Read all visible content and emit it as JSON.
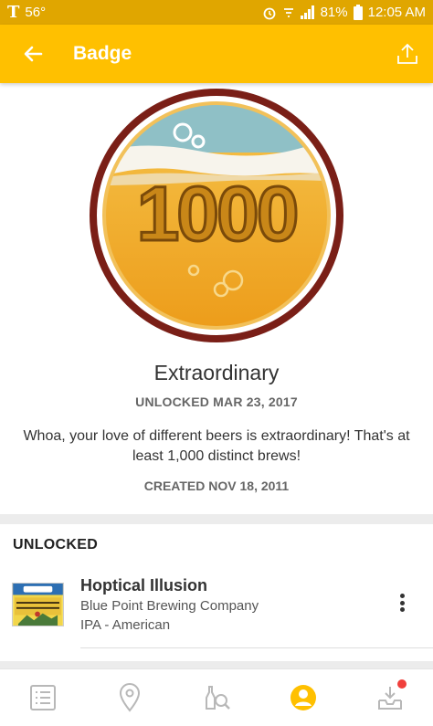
{
  "status_bar": {
    "temperature": "56°",
    "battery": "81%",
    "time": "12:05 AM"
  },
  "app_bar": {
    "title": "Badge"
  },
  "badge": {
    "number_art": "1000",
    "name": "Extraordinary",
    "unlocked_date": "UNLOCKED MAR 23, 2017",
    "description": "Whoa, your love of different beers is extraordinary! That's at least 1,000 distinct brews!",
    "created_date": "CREATED NOV 18, 2011"
  },
  "unlocked": {
    "heading": "UNLOCKED",
    "items": [
      {
        "beer_name": "Hoptical Illusion",
        "brewery": "Blue Point Brewing Company",
        "style": "IPA - American"
      }
    ]
  },
  "bottom_nav": {
    "items": [
      "feed-icon",
      "location-pin-icon",
      "beer-search-icon",
      "profile-icon",
      "inbox-icon"
    ],
    "active_index": 3
  },
  "colors": {
    "status_bar": "#e0a600",
    "app_bar": "#ffc000",
    "active_nav": "#ffc000",
    "notification": "#f0403c"
  }
}
